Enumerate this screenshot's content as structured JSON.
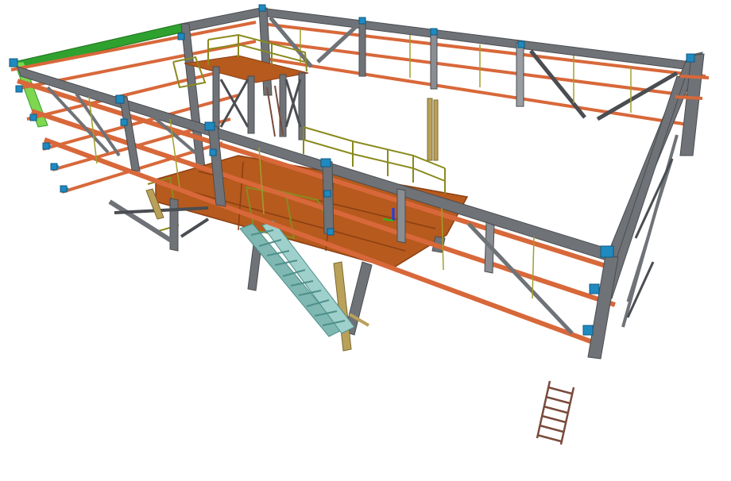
{
  "scene": {
    "kind": "3d-steel-structure-model",
    "background": "#ffffff"
  },
  "palette": {
    "steel_gray": "#6f7276",
    "steel_gray_dark": "#4a4d51",
    "steel_gray_light": "#9a9da1",
    "purlin_orange": "#d8683a",
    "purlin_orange_dark": "#a9461f",
    "deck_brown": "#b65a1e",
    "deck_brown_dark": "#8a3f12",
    "handrail_olive": "#8a8a1e",
    "stair_teal": "#7fb7b2",
    "stair_teal_dark": "#4f8f8a",
    "highlight_green": "#2fa12f",
    "highlight_green_light": "#7fd64f",
    "connector_blue": "#1f8ac0",
    "ladder_brown": "#7a4a3a",
    "post_tan": "#b9a15a",
    "axis_blue": "#1a3cff",
    "axis_green": "#19c219"
  }
}
